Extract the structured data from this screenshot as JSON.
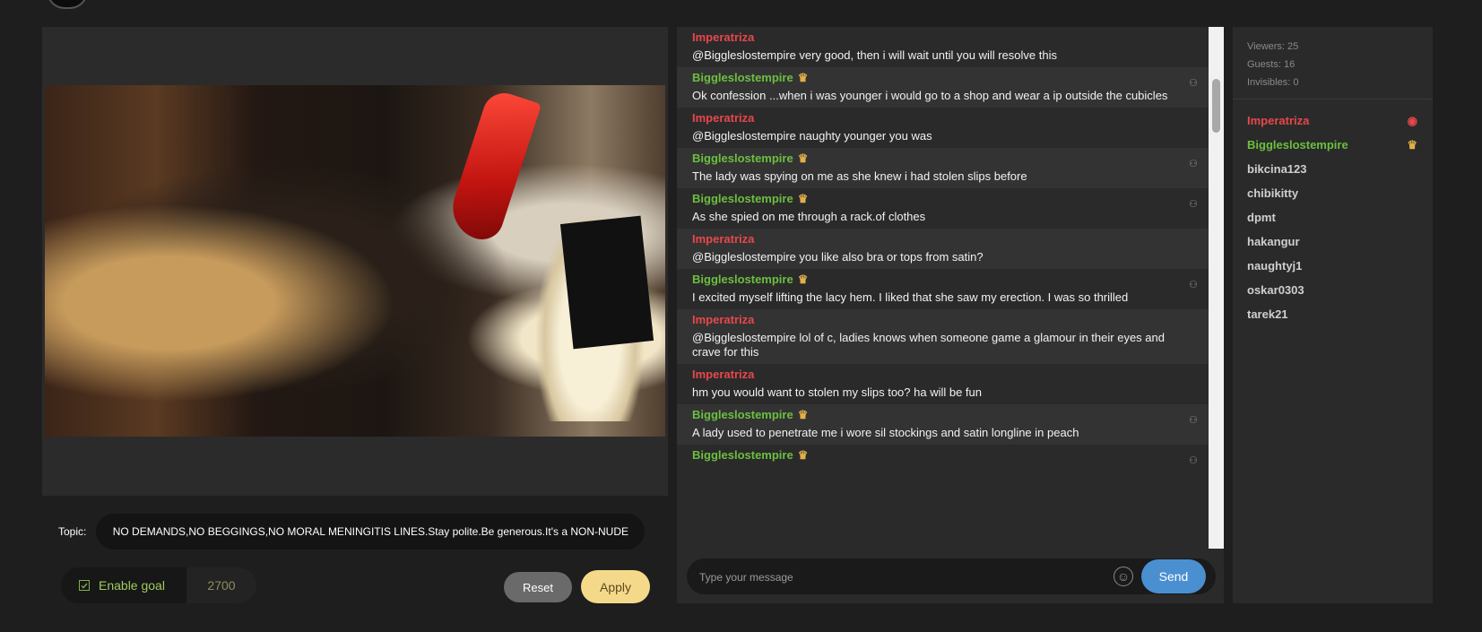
{
  "topic": {
    "label": "Topic:",
    "text": "NO DEMANDS,NO BEGGINGS,NO MORAL MENINGITIS LINES.Stay polite.Be generous.It's a NON-NUDE"
  },
  "goal": {
    "label": "Enable goal",
    "value": "2700",
    "enabled": true
  },
  "buttons": {
    "reset": "Reset",
    "apply": "Apply",
    "send": "Send"
  },
  "chat": {
    "input_placeholder": "Type your message",
    "messages": [
      {
        "user": "Imperatriza",
        "role": "host",
        "text": "@Biggleslostempire very good, then i will wait until you will resolve this"
      },
      {
        "user": "Biggleslostempire",
        "role": "guest",
        "text": "Ok confession ...when i was younger i would go to a shop and wear a ip outside the cubicles"
      },
      {
        "user": "Imperatriza",
        "role": "host",
        "text": "@Biggleslostempire naughty younger you was"
      },
      {
        "user": "Biggleslostempire",
        "role": "guest",
        "text": "The lady was spying on me as she knew i had stolen slips before"
      },
      {
        "user": "Biggleslostempire",
        "role": "guest",
        "text": "As she spied on me through a rack.of clothes"
      },
      {
        "user": "Imperatriza",
        "role": "host",
        "text": "@Biggleslostempire you like also bra or tops from satin?"
      },
      {
        "user": "Biggleslostempire",
        "role": "guest",
        "text": "I excited myself lifting the lacy hem. I liked that she saw my erection. I was so thrilled"
      },
      {
        "user": "Imperatriza",
        "role": "host",
        "text": "@Biggleslostempire lol of c, ladies knows when someone game a glamour in their eyes and crave for this"
      },
      {
        "user": "Imperatriza",
        "role": "host",
        "text": "hm you would want to stolen my slips too? ha will be fun"
      },
      {
        "user": "Biggleslostempire",
        "role": "guest",
        "text": "A lady used to penetrate me i wore sil stockings and satin longline in peach"
      },
      {
        "user": "Biggleslostempire",
        "role": "guest",
        "text": ""
      }
    ]
  },
  "stats": {
    "viewers": "Viewers: 25",
    "guests": "Guests: 16",
    "invisibles": "Invisibles: 0"
  },
  "users": [
    {
      "name": "Imperatriza",
      "role": "host",
      "icon": "webcam-icon"
    },
    {
      "name": "Biggleslostempire",
      "role": "guest",
      "icon": "crown-icon"
    },
    {
      "name": "bikcina123",
      "role": "user"
    },
    {
      "name": "chibikitty",
      "role": "user"
    },
    {
      "name": "dpmt",
      "role": "user"
    },
    {
      "name": "hakangur",
      "role": "user"
    },
    {
      "name": "naughtyj1",
      "role": "user"
    },
    {
      "name": "oskar0303",
      "role": "user"
    },
    {
      "name": "tarek21",
      "role": "user"
    }
  ],
  "colors": {
    "host_name": "#e8474c",
    "guest_name": "#6cbf3f",
    "crown": "#e2b04a",
    "send_button": "#4a8fd0",
    "apply_button": "#f5d98a"
  }
}
